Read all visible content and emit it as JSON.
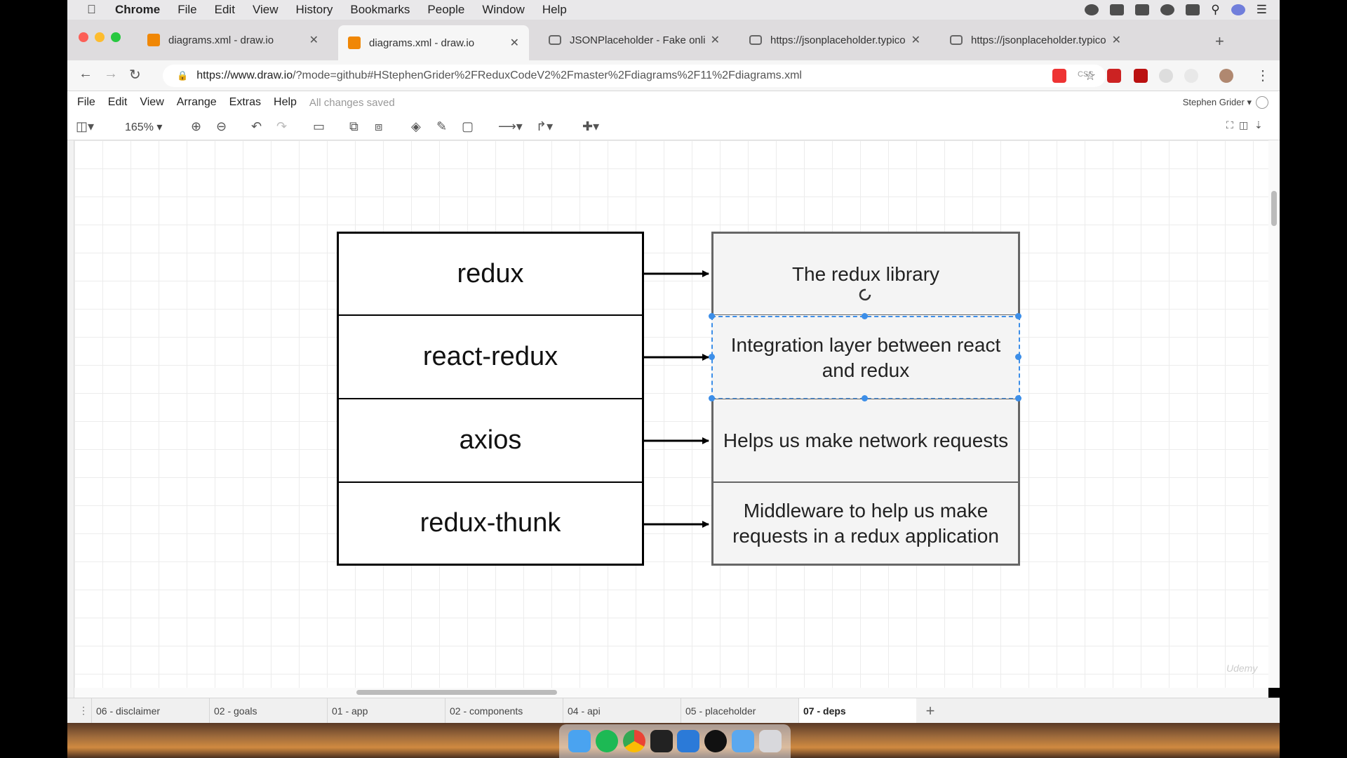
{
  "os_menubar": {
    "app": "Chrome",
    "items": [
      "File",
      "Edit",
      "View",
      "History",
      "Bookmarks",
      "People",
      "Window",
      "Help"
    ]
  },
  "browser": {
    "tabs": [
      {
        "title": "diagrams.xml - draw.io",
        "favicon": "drawio-icon",
        "active": false
      },
      {
        "title": "diagrams.xml - draw.io",
        "favicon": "drawio-icon",
        "active": true
      },
      {
        "title": "JSONPlaceholder - Fake online",
        "favicon": "json-icon",
        "active": false
      },
      {
        "title": "https://jsonplaceholder.typicode",
        "favicon": "json-icon",
        "active": false
      },
      {
        "title": "https://jsonplaceholder.typicode",
        "favicon": "json-icon",
        "active": false
      }
    ],
    "url_host": "https://www.draw.io",
    "url_path": "/?mode=github#HStephenGrider%2FReduxCodeV2%2Fmaster%2Fdiagrams%2F11%2Fdiagrams.xml",
    "ext_css_label": "CSS"
  },
  "drawio": {
    "menu": [
      "File",
      "Edit",
      "View",
      "Arrange",
      "Extras",
      "Help"
    ],
    "save_status": "All changes saved",
    "user": "Stephen Grider",
    "zoom": "165%"
  },
  "diagram": {
    "libraries": [
      "redux",
      "react-redux",
      "axios",
      "redux-thunk"
    ],
    "descriptions": [
      "The redux library",
      "Integration layer between react and redux",
      "Helps us make network requests",
      "Middleware to help us make requests in a redux application"
    ],
    "selected_index": 1,
    "selection_color": "#3c8ee8"
  },
  "pages": {
    "tabs": [
      "06 - disclaimer",
      "02 - goals",
      "01 - app",
      "02 - components",
      "04 - api",
      "05 - placeholder",
      "07 - deps"
    ],
    "active": "07 - deps"
  },
  "watermark": "Udemy"
}
